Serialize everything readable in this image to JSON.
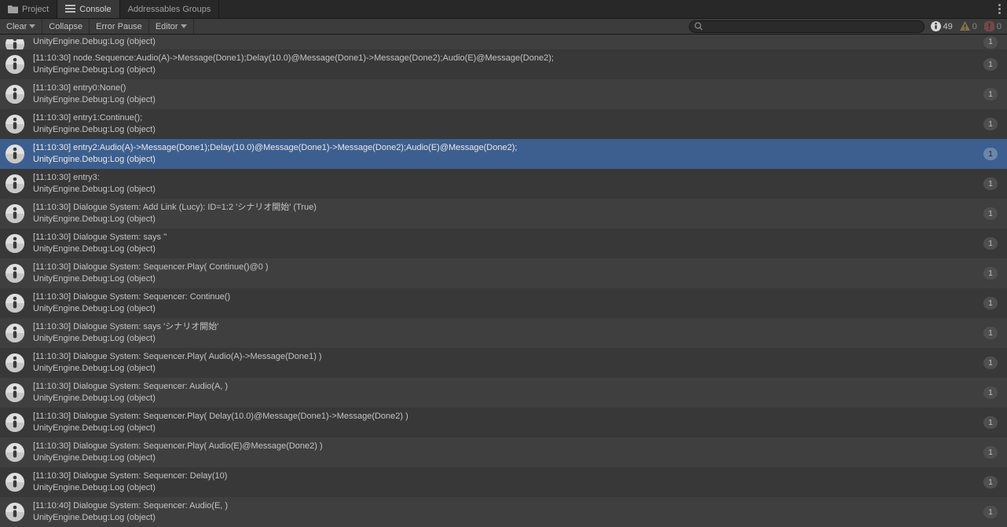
{
  "tabs": {
    "project": "Project",
    "console": "Console",
    "addressables": "Addressables Groups"
  },
  "toolbar": {
    "clear": "Clear",
    "collapse": "Collapse",
    "error_pause": "Error Pause",
    "editor": "Editor"
  },
  "search": {
    "placeholder": ""
  },
  "counts": {
    "info": "49",
    "warn": "0",
    "error": "0"
  },
  "debug_line": "UnityEngine.Debug:Log (object)",
  "entries": [
    {
      "line1": "UnityEngine.Debug:Log (object)",
      "line2": "",
      "count": "1",
      "half": true
    },
    {
      "line1": "[11:10:30] node.Sequence:Audio(A)->Message(Done1);Delay(10.0)@Message(Done1)->Message(Done2);Audio(E)@Message(Done2);",
      "line2": "UnityEngine.Debug:Log (object)",
      "count": "1"
    },
    {
      "line1": "[11:10:30] entry0:None()",
      "line2": "UnityEngine.Debug:Log (object)",
      "count": "1"
    },
    {
      "line1": "[11:10:30] entry1:Continue();",
      "line2": "UnityEngine.Debug:Log (object)",
      "count": "1"
    },
    {
      "line1": "[11:10:30] entry2:Audio(A)->Message(Done1);Delay(10.0)@Message(Done1)->Message(Done2);Audio(E)@Message(Done2);",
      "line2": "UnityEngine.Debug:Log (object)",
      "count": "1",
      "selected": true
    },
    {
      "line1": "[11:10:30] entry3:",
      "line2": "UnityEngine.Debug:Log (object)",
      "count": "1"
    },
    {
      "line1": "[11:10:30] Dialogue System: Add Link (Lucy): ID=1:2 'シナリオ開始' (True)",
      "line2": "UnityEngine.Debug:Log (object)",
      "count": "1"
    },
    {
      "line1": "[11:10:30] Dialogue System:  says ''",
      "line2": "UnityEngine.Debug:Log (object)",
      "count": "1"
    },
    {
      "line1": "[11:10:30] Dialogue System: Sequencer.Play( Continue()@0 )",
      "line2": "UnityEngine.Debug:Log (object)",
      "count": "1"
    },
    {
      "line1": "[11:10:30] Dialogue System: Sequencer: Continue()",
      "line2": "UnityEngine.Debug:Log (object)",
      "count": "1"
    },
    {
      "line1": "[11:10:30] Dialogue System:  says 'シナリオ開始'",
      "line2": "UnityEngine.Debug:Log (object)",
      "count": "1"
    },
    {
      "line1": "[11:10:30] Dialogue System: Sequencer.Play( Audio(A)->Message(Done1) )",
      "line2": "UnityEngine.Debug:Log (object)",
      "count": "1"
    },
    {
      "line1": "[11:10:30] Dialogue System: Sequencer: Audio(A, )",
      "line2": "UnityEngine.Debug:Log (object)",
      "count": "1"
    },
    {
      "line1": "[11:10:30] Dialogue System: Sequencer.Play( Delay(10.0)@Message(Done1)->Message(Done2) )",
      "line2": "UnityEngine.Debug:Log (object)",
      "count": "1"
    },
    {
      "line1": "[11:10:30] Dialogue System: Sequencer.Play( Audio(E)@Message(Done2) )",
      "line2": "UnityEngine.Debug:Log (object)",
      "count": "1"
    },
    {
      "line1": "[11:10:30] Dialogue System: Sequencer: Delay(10)",
      "line2": "UnityEngine.Debug:Log (object)",
      "count": "1"
    },
    {
      "line1": "[11:10:40] Dialogue System: Sequencer: Audio(E, )",
      "line2": "UnityEngine.Debug:Log (object)",
      "count": "1"
    }
  ]
}
